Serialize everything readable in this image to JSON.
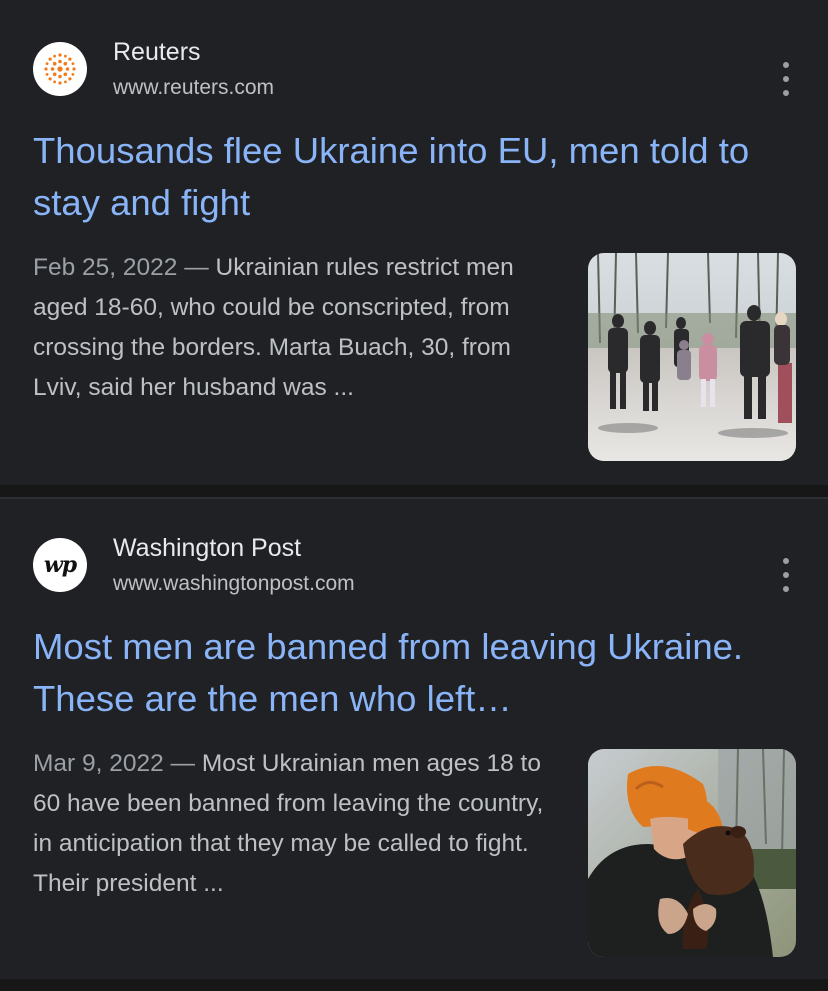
{
  "results": [
    {
      "source_name": "Reuters",
      "url": "www.reuters.com",
      "title": "Thousands flee Ukraine into EU, men told to stay and fight",
      "date": "Feb 25, 2022",
      "separator": " — ",
      "snippet": "Ukrainian rules restrict men aged 18-60, who could be conscripted, from crossing the borders. Marta Buach, 30, from Lviv, said her husband was ...",
      "logo_icon": "reuters-logo-icon",
      "thumbnail": "people-walking-border-crossing-image"
    },
    {
      "source_name": "Washington Post",
      "url": "www.washingtonpost.com",
      "title": "Most men are banned from leaving Ukraine. These are the men who left…",
      "date": "Mar 9, 2022",
      "separator": " — ",
      "snippet": "Most Ukrainian men ages 18 to 60 have been banned from leaving the country, in anticipation that they may be called to fight. Their president ...",
      "logo_icon": "washington-post-logo-icon",
      "logo_text": "wp",
      "thumbnail": "man-holding-dog-image"
    }
  ],
  "colors": {
    "background": "#202124",
    "separator": "#171717",
    "link": "#8ab4f8",
    "source_text": "#e8eaed",
    "secondary_text": "#bdc1c6",
    "date_text": "#9aa0a6",
    "reuters_orange": "#f27a1a"
  }
}
